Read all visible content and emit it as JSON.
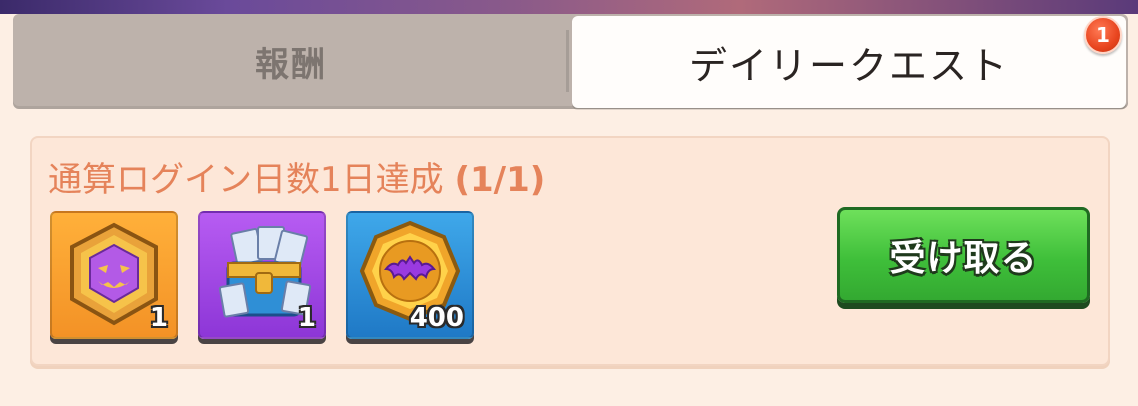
{
  "tabs": {
    "rewards_label": "報酬",
    "daily_quest_label": "デイリークエスト",
    "daily_quest_badge": "1",
    "active_tab": "daily_quest"
  },
  "quest": {
    "title": "通算ログイン日数1日達成",
    "progress": "(1/1)",
    "rewards": [
      {
        "icon": "pumpkin-hexagon-badge-icon",
        "count": "1"
      },
      {
        "icon": "exp-ticket-chest-icon",
        "count": "1"
      },
      {
        "icon": "bat-gold-coin-icon",
        "count": "400"
      }
    ],
    "claim_label": "受け取る"
  },
  "colors": {
    "title_orange": "#e5835a",
    "claim_green": "#3fbf3a",
    "badge_red": "#e8451f",
    "panel_bg": "#fdefe4"
  }
}
